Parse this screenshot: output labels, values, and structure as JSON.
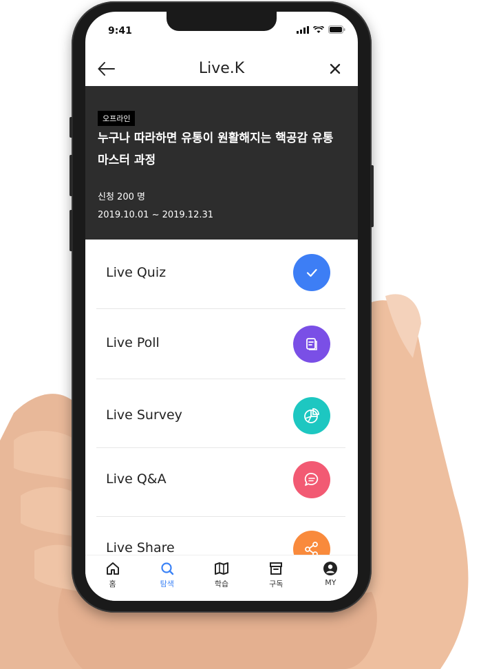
{
  "status_bar": {
    "time": "9:41"
  },
  "nav": {
    "title": "Live.K"
  },
  "event": {
    "badge": "오프라인",
    "title": "누구나 따라하면 유통이 원활해지는 핵공감 유통 마스터 과정",
    "applicants": "신청  200 명",
    "date_range": "2019.10.01 ~ 2019.12.31"
  },
  "features": [
    {
      "label": "Live Quiz",
      "icon": "check-icon",
      "color": "#3d7ef5"
    },
    {
      "label": "Live Poll",
      "icon": "poll-icon",
      "color": "#7a4fe6"
    },
    {
      "label": "Live Survey",
      "icon": "pie-chart-icon",
      "color": "#1dc7c1"
    },
    {
      "label": "Live Q&A",
      "icon": "chat-bubble-icon",
      "color": "#f25a73"
    },
    {
      "label": "Live Share",
      "icon": "share-icon",
      "color": "#f98a3c"
    }
  ],
  "tabs": [
    {
      "label": "홈",
      "icon": "home-icon"
    },
    {
      "label": "탐색",
      "icon": "search-icon",
      "active": true
    },
    {
      "label": "학습",
      "icon": "book-icon"
    },
    {
      "label": "구독",
      "icon": "archive-icon"
    },
    {
      "label": "MY",
      "icon": "user-icon"
    }
  ],
  "colors": {
    "accent": "#3b82f6",
    "header_bg": "#2d2d2d"
  }
}
